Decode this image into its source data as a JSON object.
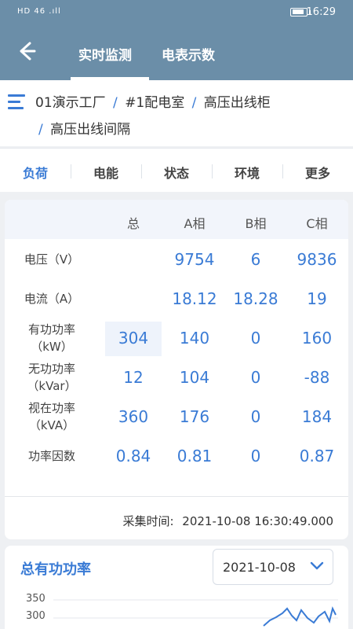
{
  "status_bar": {
    "signal": "HD 46 .ıll",
    "time": "16:29"
  },
  "app_bar": {
    "tabs": [
      "实时监测",
      "电表示数"
    ]
  },
  "breadcrumb": {
    "parts": [
      "01演示工厂",
      "#1配电室",
      "高压出线柜"
    ],
    "last": "高压出线间隔",
    "separator": "/"
  },
  "subtabs": [
    "负荷",
    "电能",
    "状态",
    "环境",
    "更多"
  ],
  "table": {
    "columns": [
      "总",
      "A相",
      "B相",
      "C相"
    ],
    "rows": [
      {
        "label": "电压（V）",
        "total": "",
        "a": "9754",
        "b": "6",
        "c": "9836"
      },
      {
        "label": "电流（A）",
        "total": "",
        "a": "18.12",
        "b": "18.28",
        "c": "19"
      },
      {
        "label": "有功功率\n（kW）",
        "total": "304",
        "a": "140",
        "b": "0",
        "c": "160"
      },
      {
        "label": "无功功率\n（kVar）",
        "total": "12",
        "a": "104",
        "b": "0",
        "c": "-88"
      },
      {
        "label": "视在功率\n（kVA）",
        "total": "360",
        "a": "176",
        "b": "0",
        "c": "184"
      },
      {
        "label": "功率因数",
        "total": "0.84",
        "a": "0.81",
        "b": "0",
        "c": "0.87"
      }
    ],
    "collect_label": "采集时间:",
    "collect_time": "2021-10-08 16:30:49.000"
  },
  "chart_section": {
    "title": "总有功功率",
    "date": "2021-10-08"
  },
  "chart_data": {
    "type": "line",
    "title": "总有功功率",
    "xlabel": "",
    "ylabel": "",
    "yticks": [
      "350",
      "300"
    ],
    "ylim": [
      300,
      350
    ]
  }
}
